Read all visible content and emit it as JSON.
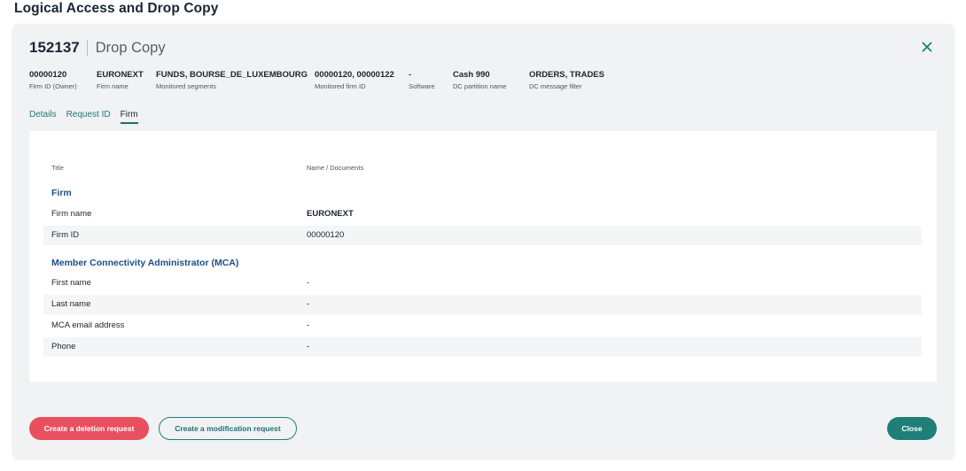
{
  "page": {
    "title": "Logical Access and Drop Copy"
  },
  "header": {
    "id": "152137",
    "type": "Drop Copy",
    "close_icon": "close-icon"
  },
  "info": [
    {
      "value": "00000120",
      "label": "Firm ID (Owner)"
    },
    {
      "value": "EURONEXT",
      "label": "Firm name"
    },
    {
      "value": "FUNDS, BOURSE_DE_LUXEMBOURG",
      "label": "Monitored segments"
    },
    {
      "value": "00000120, 00000122",
      "label": "Monitored firm ID"
    },
    {
      "value": "-",
      "label": "Software"
    },
    {
      "value": "Cash 990",
      "label": "DC partition name"
    },
    {
      "value": "ORDERS, TRADES",
      "label": "DC message filter"
    }
  ],
  "tabs": [
    {
      "label": "Details",
      "active": false
    },
    {
      "label": "Request ID",
      "active": false
    },
    {
      "label": "Firm",
      "active": true
    }
  ],
  "table": {
    "col_title": "Title",
    "col_name": "Name / Documents",
    "sections": [
      {
        "title": "Firm",
        "rows": [
          {
            "label": "Firm name",
            "value": "EURONEXT"
          },
          {
            "label": "Firm ID",
            "value": "00000120"
          }
        ]
      },
      {
        "title": "Member Connectivity Administrator (MCA)",
        "rows": [
          {
            "label": "First name",
            "value": "-"
          },
          {
            "label": "Last name",
            "value": "-"
          },
          {
            "label": "MCA email address",
            "value": "-"
          },
          {
            "label": "Phone",
            "value": "-"
          }
        ]
      }
    ]
  },
  "footer": {
    "delete_label": "Create a deletion request",
    "modify_label": "Create a modification request",
    "close_label": "Close"
  },
  "colors": {
    "accent": "#1f7f78",
    "danger": "#e8505f",
    "section": "#1b4f82"
  }
}
